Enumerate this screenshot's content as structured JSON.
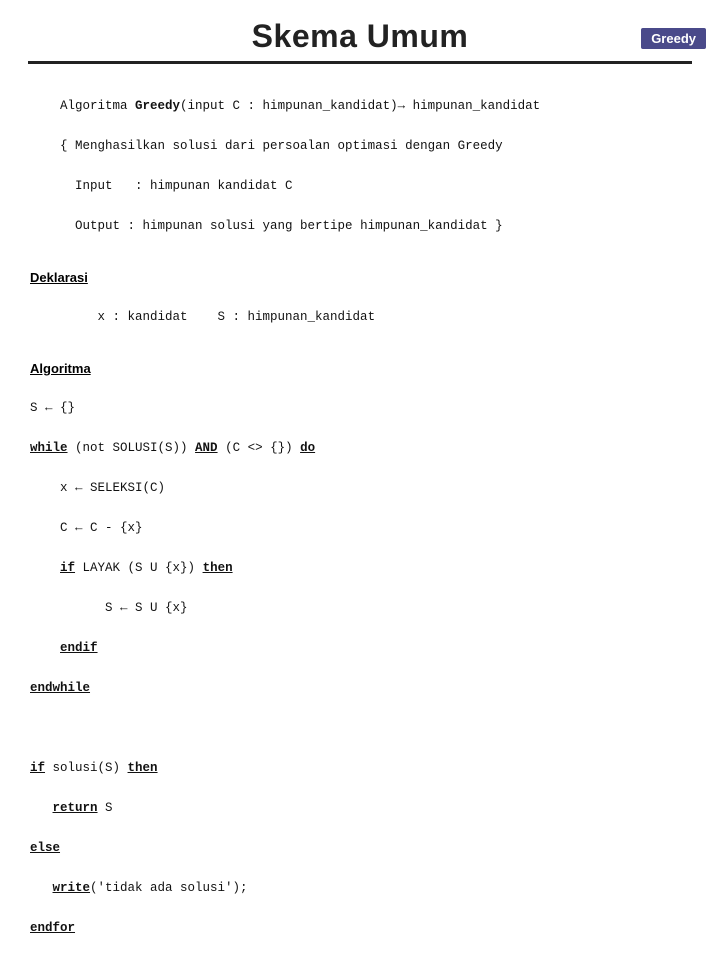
{
  "badge": {
    "label": "Greedy",
    "bg": "#4a4a8a",
    "color": "#ffffff"
  },
  "title": "Skema Umum",
  "sections": {
    "description": {
      "line1": "Algoritma Greedy(input C : himpunan_kandidat)→ himpunan_kandidat",
      "line2": "{ Menghasilkan solusi dari persoalan optimasi dengan Greedy",
      "line3": "  Input   : himpunan kandidat C",
      "line4": "  Output : himpunan solusi yang bertipe himpunan_kandidat }"
    },
    "deklarasi": {
      "header": "Deklarasi",
      "content": "   x : kandidat    S : himpunan_kandidat"
    },
    "algoritma": {
      "header": "Algoritma",
      "lines": [
        "S ← {}",
        "while (not SOLUSI(S)) AND (C <> {}) do",
        "    x ← SELEKSI(C)",
        "    C ← C - {x}",
        "    if LAYAK (S U {x}) then",
        "          S ← S U {x}",
        "    endif",
        "endwhile",
        "",
        "if solusi(S) then",
        "   return S",
        "else",
        "   write('tidak ada solusi');",
        "endfor"
      ]
    }
  }
}
